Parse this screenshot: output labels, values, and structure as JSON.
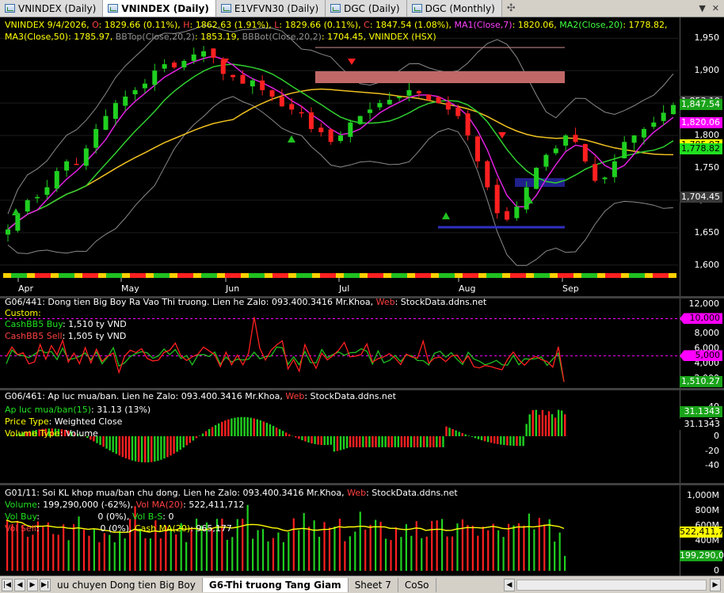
{
  "tabs": [
    {
      "label": "VNINDEX (Daily)",
      "active": false
    },
    {
      "label": "VNINDEX (Daily)",
      "active": true
    },
    {
      "label": "E1VFVN30 (Daily)",
      "active": false
    },
    {
      "label": "DGC (Daily)",
      "active": false
    },
    {
      "label": "DGC (Monthly)",
      "active": false
    }
  ],
  "tab_add": "✣",
  "window_controls": [
    "▼",
    "✕"
  ],
  "price_pane": {
    "line1_parts": [
      {
        "t": "VNINDEX 9/4/2026, ",
        "c": "#ffff00"
      },
      {
        "t": "O",
        "c": "#ff4040"
      },
      {
        "t": ": 1829.66 (0.11%), ",
        "c": "#ffff00"
      },
      {
        "t": "H",
        "c": "#ff4040"
      },
      {
        "t": ": 1862.63 (1.91%), ",
        "c": "#ffff00"
      },
      {
        "t": "L",
        "c": "#ff4040"
      },
      {
        "t": ": 1829.66 (0.11%), ",
        "c": "#ffff00"
      },
      {
        "t": "C",
        "c": "#ff4040"
      },
      {
        "t": ": 1847.54 (1.08%), ",
        "c": "#ffff00"
      },
      {
        "t": "MA1(Close,7)",
        "c": "#ff40ff"
      },
      {
        "t": ": 1820.06, ",
        "c": "#ffff00"
      },
      {
        "t": "MA2(Close,20)",
        "c": "#40ff40"
      },
      {
        "t": ": 1778.82,",
        "c": "#ffff00"
      }
    ],
    "line2_parts": [
      {
        "t": "MA3(Close,50)",
        "c": "#ffff00"
      },
      {
        "t": ": 1785.97, ",
        "c": "#ffff00"
      },
      {
        "t": "BBTop(Close,20,2)",
        "c": "#909090"
      },
      {
        "t": ": 1853.19, ",
        "c": "#ffff00"
      },
      {
        "t": "BBBot(Close,20,2)",
        "c": "#909090"
      },
      {
        "t": ": 1704.45, ",
        "c": "#ffff00"
      },
      {
        "t": "VNINDEX (HSX)",
        "c": "#ffff00"
      }
    ],
    "ticks": [
      "1,950",
      "1,900",
      "1,850",
      "1,800",
      "1,750",
      "1,700",
      "1,650",
      "1,600"
    ],
    "months": [
      "Apr",
      "May",
      "Jun",
      "Jul",
      "Aug",
      "Sep"
    ],
    "badges": [
      {
        "text": "1,853.19",
        "bg": "#3a3a3a",
        "fg": "#ffffff"
      },
      {
        "text": "1,847.54",
        "bg": "#1aa31a",
        "fg": "#ffffff"
      },
      {
        "text": "1,820.06",
        "bg": "#ff00ff",
        "fg": "#ffffff"
      },
      {
        "text": "1,785.97",
        "bg": "#ffff00",
        "fg": "#000000"
      },
      {
        "text": "1,778.82",
        "bg": "#20e020",
        "fg": "#000000"
      },
      {
        "text": "1,704.45",
        "bg": "#3a3a3a",
        "fg": "#ffffff"
      }
    ]
  },
  "cash_pane": {
    "title_parts": [
      {
        "t": "G06/441: Dong tien Big Boy Ra Vao Thi truong. Lien he Zalo: 093.400.3416 Mr.Khoa, ",
        "c": "#ffffff"
      },
      {
        "t": "Web",
        "c": "#ff4040"
      },
      {
        "t": ": StockData.ddns.net",
        "c": "#ffffff"
      }
    ],
    "custom_label": "Custom:",
    "buy_label": "CashBB5 Buy",
    "buy_value": ": 1,510 ty VND",
    "sell_label": "CashBB5 Sell",
    "sell_value": ": 1,505 ty VND",
    "ticks": [
      "12,000",
      "10,000",
      "8,000",
      "6,000",
      "4,000",
      "2,000"
    ],
    "badges": [
      {
        "text": "10,000",
        "bg": "#ff00ff",
        "fg": "#000000"
      },
      {
        "text": "5,000",
        "bg": "#ff00ff",
        "fg": "#000000"
      },
      {
        "text": "1,510.27",
        "bg": "#1aa31a",
        "fg": "#ffffff"
      }
    ]
  },
  "pressure_pane": {
    "title_parts": [
      {
        "t": "G06/461: Ap luc mua/ban. Lien he Zalo: 093.400.3416 Mr.Khoa, ",
        "c": "#ffffff"
      },
      {
        "t": "Web",
        "c": "#ff4040"
      },
      {
        "t": ": StockData.ddns.net",
        "c": "#ffffff"
      }
    ],
    "line_label": "Ap luc mua/ban(15)",
    "line_value": ": 31.13 (13%)",
    "price_type_label": "Price Type",
    "price_type_value": ": Weighted Close",
    "volume_type_label": "Volume Type",
    "volume_type_value": ": Volume",
    "ticks": [
      "40",
      "20",
      "0",
      "-20",
      "-40"
    ],
    "badges": [
      {
        "text": "31.1343",
        "bg": "#1aa31a",
        "fg": "#ffffff"
      },
      {
        "text": "31.1343",
        "bg": "#000000",
        "fg": "#ffffff"
      }
    ]
  },
  "volume_pane": {
    "title_parts": [
      {
        "t": "G01/11: Soi KL khop mua/ban chu dong. Lien he Zalo: 093.400.3416 Mr.Khoa, ",
        "c": "#ffffff"
      },
      {
        "t": "Web",
        "c": "#ff4040"
      },
      {
        "t": ": StockData.ddns.net",
        "c": "#ffffff"
      }
    ],
    "row1_parts": [
      {
        "t": "Volume",
        "c": "#20e020"
      },
      {
        "t": ": 199,290,000 (-62%), ",
        "c": "#ffffff"
      },
      {
        "t": "Vol MA(20)",
        "c": "#ff4040"
      },
      {
        "t": ": 522,411,712",
        "c": "#ffffff"
      }
    ],
    "row2_parts": [
      {
        "t": "Vol Buy",
        "c": "#20e020"
      },
      {
        "t": ":                     0 (0%), ",
        "c": "#ffffff"
      },
      {
        "t": "Vol B-S",
        "c": "#20e020"
      },
      {
        "t": ": 0",
        "c": "#ffffff"
      }
    ],
    "row3_parts": [
      {
        "t": "Vol Sell",
        "c": "#ff4040"
      },
      {
        "t": ":                      0 (0%), ",
        "c": "#ffffff"
      },
      {
        "t": "Cash MA(20)",
        "c": "#ffff00"
      },
      {
        "t": ": 965,177",
        "c": "#ffffff"
      }
    ],
    "ticks": [
      "1,000M",
      "800M",
      "600M",
      "400M",
      "200M",
      "0"
    ],
    "badges": [
      {
        "text": "522,411,7",
        "bg": "#ffff00",
        "fg": "#000000"
      },
      {
        "text": "199,290,0",
        "bg": "#1aa31a",
        "fg": "#ffffff"
      }
    ]
  },
  "sheets": [
    {
      "label": "uu chuyen Dong tien Big Boy",
      "active": false
    },
    {
      "label": "G6-Thi truong Tang Giam",
      "active": true
    },
    {
      "label": "Sheet 7",
      "active": false
    },
    {
      "label": "CoSo",
      "active": false
    }
  ],
  "nav_buttons": [
    "|◀",
    "◀",
    "▶",
    "▶|"
  ],
  "chart_data": [
    {
      "type": "candlestick",
      "title": "VNINDEX (HSX) Daily",
      "last": {
        "date": "9/4/2026",
        "open": 1829.66,
        "high": 1862.63,
        "low": 1829.66,
        "close": 1847.54
      },
      "ma7": 1820.06,
      "ma20": 1778.82,
      "ma50": 1785.97,
      "bb_top": 1853.19,
      "bb_bot": 1704.45,
      "ylim": [
        1585,
        1970
      ],
      "x_labels": [
        "Apr",
        "May",
        "Jun",
        "Jul",
        "Aug",
        "Sep"
      ],
      "close_path": [
        1655,
        1680,
        1700,
        1705,
        1720,
        1745,
        1760,
        1755,
        1780,
        1810,
        1830,
        1850,
        1860,
        1870,
        1880,
        1900,
        1910,
        1905,
        1915,
        1925,
        1930,
        1920,
        1895,
        1890,
        1880,
        1885,
        1870,
        1860,
        1845,
        1840,
        1835,
        1810,
        1805,
        1790,
        1800,
        1820,
        1830,
        1840,
        1850,
        1855,
        1860,
        1870,
        1865,
        1855,
        1850,
        1840,
        1830,
        1800,
        1760,
        1720,
        1680,
        1670,
        1690,
        1720,
        1750,
        1770,
        1780,
        1800,
        1790,
        1760,
        1730,
        1735,
        1760,
        1790,
        1800,
        1810,
        1820,
        1835,
        1847
      ]
    },
    {
      "type": "line",
      "title": "CashBB5",
      "series": [
        {
          "name": "CashBB5 Buy",
          "last": 1510
        },
        {
          "name": "CashBB5 Sell",
          "last": 1505
        }
      ],
      "ylim": [
        1000,
        12500
      ]
    },
    {
      "type": "bar",
      "title": "Ap luc mua/ban(15)",
      "last": 31.13,
      "ylim": [
        -50,
        50
      ]
    },
    {
      "type": "bar",
      "title": "Volume",
      "last": 199290000,
      "vol_ma20": 522411712,
      "ylim": [
        0,
        1100000000
      ]
    }
  ]
}
